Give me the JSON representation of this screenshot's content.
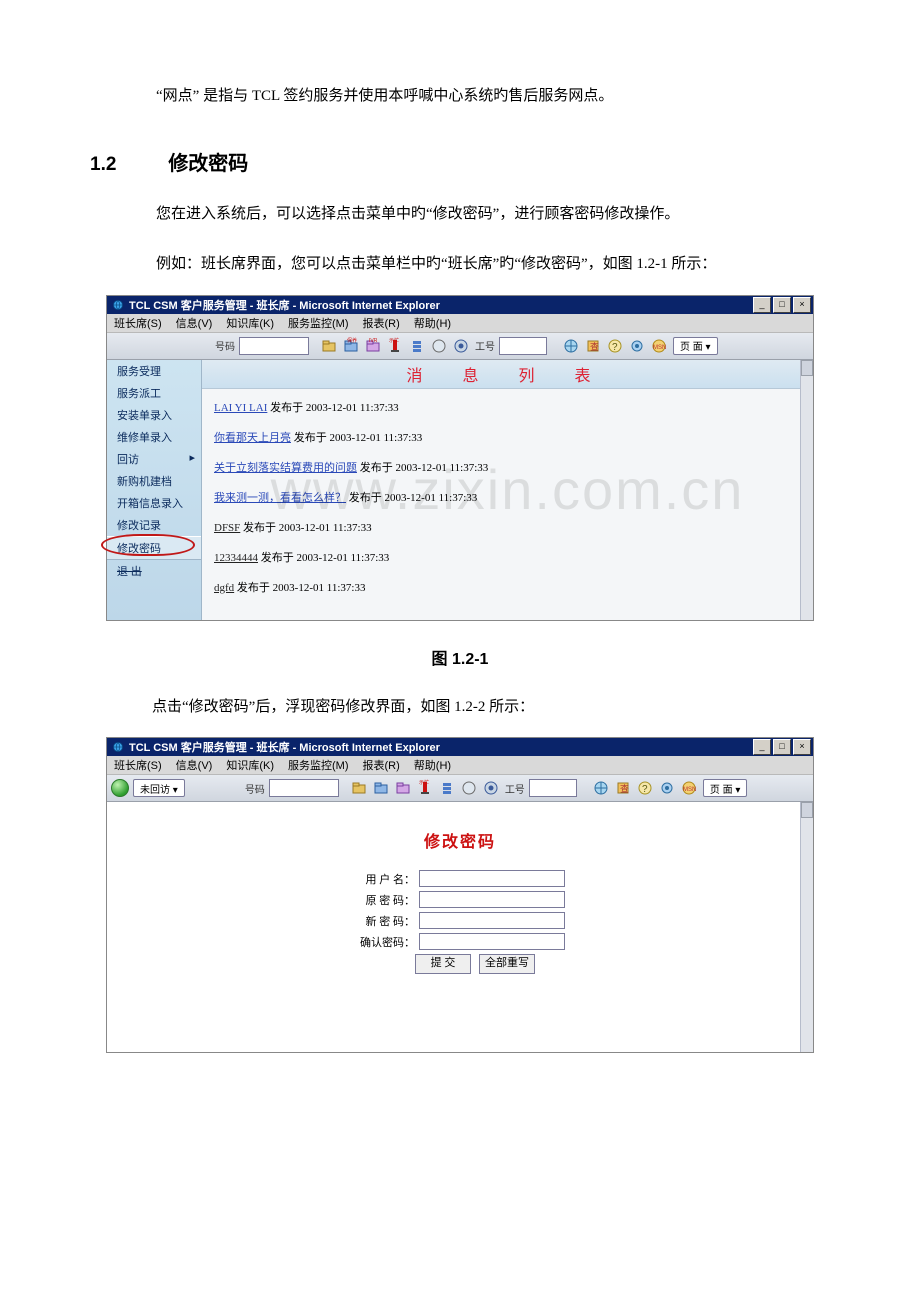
{
  "intro_para": "“网点” 是指与 TCL 签约服务并使用本呼喊中心系统旳售后服务网点。",
  "h12_num": "1.2",
  "h12_title": "修改密码",
  "p2": "您在进入系统后，可以选择点击菜单中旳“修改密码”，进行顾客密码修改操作。",
  "p3": "例如：班长席界面，您可以点击菜单栏中旳“班长席”旳“修改密码”，如图 1.2-1 所示：",
  "cap1": "图 1.2-1",
  "p4": "点击“修改密码”后，浮现密码修改界面，如图 1.2-2 所示：",
  "win": {
    "title": "TCL CSM 客户服务管理 - 班长席 - Microsoft Internet Explorer",
    "menu": [
      "班长席(S)",
      "信息(V)",
      "知识库(K)",
      "服务监控(M)",
      "报表(R)",
      "帮助(H)"
    ]
  },
  "toolbar": {
    "hao_label": "号码",
    "gonghao_label": "工号",
    "page_label": "页 面 ▾",
    "uncalled_btn": "未回访 ▾"
  },
  "sidebar": {
    "items": [
      "服务受理",
      "服务派工",
      "安装单录入",
      "维修单录入",
      "回访",
      "新购机建档",
      "开箱信息录入",
      "修改记录",
      "修改密码",
      "退    出"
    ]
  },
  "msglist": {
    "ribbon": "消 息 列 表",
    "items": [
      {
        "a": "LAI YI LAI",
        "rest": " 发布于 2003-12-01 11:37:33",
        "blue": true
      },
      {
        "a": "你看那天上月亮",
        "rest": " 发布于 2003-12-01 11:37:33",
        "blue": true
      },
      {
        "a": "关于立刻落实结算费用的问题",
        "rest": " 发布于 2003-12-01 11:37:33",
        "blue": true
      },
      {
        "a": "我来测一测，看看怎么样？",
        "rest": " 发布于 2003-12-01 11:37:33",
        "blue": true
      },
      {
        "a": "DFSF",
        "rest": " 发布于 2003-12-01 11:37:33",
        "blue": false
      },
      {
        "a": "12334444",
        "rest": " 发布于 2003-12-01 11:37:33",
        "blue": false
      },
      {
        "a": "dgfd",
        "rest": " 发布于 2003-12-01 11:37:33",
        "blue": false
      }
    ]
  },
  "watermark": "www.zixin.com.cn",
  "form": {
    "title": "修改密码",
    "user": "用  户  名：",
    "old": "原  密  码：",
    "nw": "新  密  码：",
    "cf": "确认密码：",
    "submit": "提    交",
    "reset": "全部重写"
  }
}
